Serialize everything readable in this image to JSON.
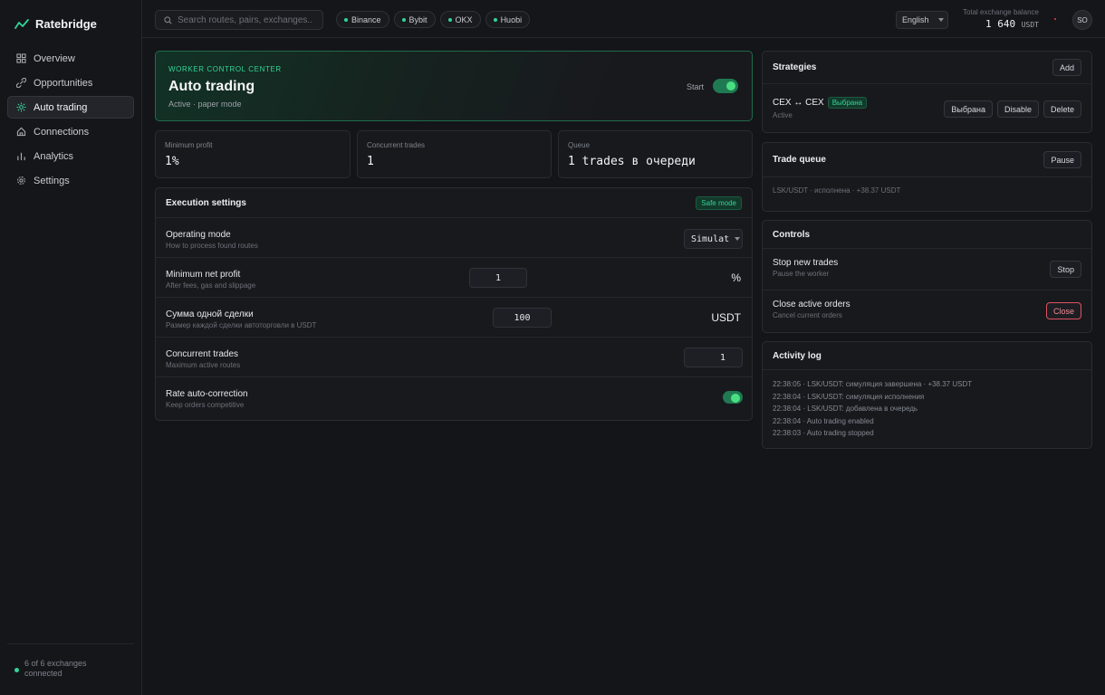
{
  "brand": {
    "name": "Ratebridge"
  },
  "nav": [
    {
      "label": "Overview",
      "icon": "grid-icon",
      "active": false
    },
    {
      "label": "Opportunities",
      "icon": "link-icon",
      "active": false
    },
    {
      "label": "Auto trading",
      "icon": "gear-spark-icon",
      "active": true
    },
    {
      "label": "Connections",
      "icon": "home-icon",
      "active": false
    },
    {
      "label": "Analytics",
      "icon": "bars-icon",
      "active": false
    },
    {
      "label": "Settings",
      "icon": "cog-icon",
      "active": false
    }
  ],
  "sidebar_footer": {
    "status": "6 of 6 exchanges connected"
  },
  "topbar": {
    "search_placeholder": "Search routes, pairs, exchanges...",
    "exchanges": [
      "Binance",
      "Bybit",
      "OKX",
      "Huobi"
    ],
    "language": "English",
    "balance_label": "Total exchange balance",
    "balance_value": "1 640",
    "balance_unit": "USDT",
    "avatar": "SO"
  },
  "hero": {
    "kicker": "WORKER CONTROL CENTER",
    "title": "Auto trading",
    "subtitle": "Active · paper mode",
    "toggle_label": "Start"
  },
  "stats": [
    {
      "label": "Minimum profit",
      "value": "1%"
    },
    {
      "label": "Concurrent trades",
      "value": "1"
    },
    {
      "label": "Queue",
      "value": "1 trades в очереди"
    }
  ],
  "execution": {
    "title": "Execution settings",
    "badge": "Safe mode",
    "rows": [
      {
        "title": "Operating mode",
        "sub": "How to process found routes",
        "value": "Simulat"
      },
      {
        "title": "Minimum net profit",
        "sub": "After fees, gas and slippage",
        "value": "1",
        "unit": "%"
      },
      {
        "title": "Сумма одной сделки",
        "sub": "Размер каждой сделки автоторговли в USDT",
        "value": "100",
        "unit": "USDT"
      },
      {
        "title": "Concurrent trades",
        "sub": "Maximum active routes",
        "value": "1"
      },
      {
        "title": "Rate auto-correction",
        "sub": "Keep orders competitive"
      }
    ]
  },
  "strategies": {
    "title": "Strategies",
    "add_label": "Add",
    "item": {
      "name": "CEX ↔ CEX",
      "badge": "Выбрана",
      "status": "Active",
      "btn_selected": "Выбрана",
      "btn_disable": "Disable",
      "btn_delete": "Delete"
    }
  },
  "queue": {
    "title": "Trade queue",
    "pause_label": "Pause",
    "line": "LSK/USDT · исполнена · +38.37 USDT"
  },
  "controls": {
    "title": "Controls",
    "stop_title": "Stop new trades",
    "stop_sub": "Pause the worker",
    "stop_label": "Stop",
    "close_title": "Close active orders",
    "close_sub": "Cancel current orders",
    "close_label": "Close"
  },
  "activity": {
    "title": "Activity log",
    "lines": [
      "22:38:05 · LSK/USDT: симуляция завершена · +38.37 USDT",
      "22:38:04 · LSK/USDT: симуляция исполнения",
      "22:38:04 · LSK/USDT: добавлена в очередь",
      "22:38:04 · Auto trading enabled",
      "22:38:03 · Auto trading stopped"
    ]
  },
  "colors": {
    "accent": "#34d399",
    "danger": "#e05260",
    "background": "#141518"
  }
}
